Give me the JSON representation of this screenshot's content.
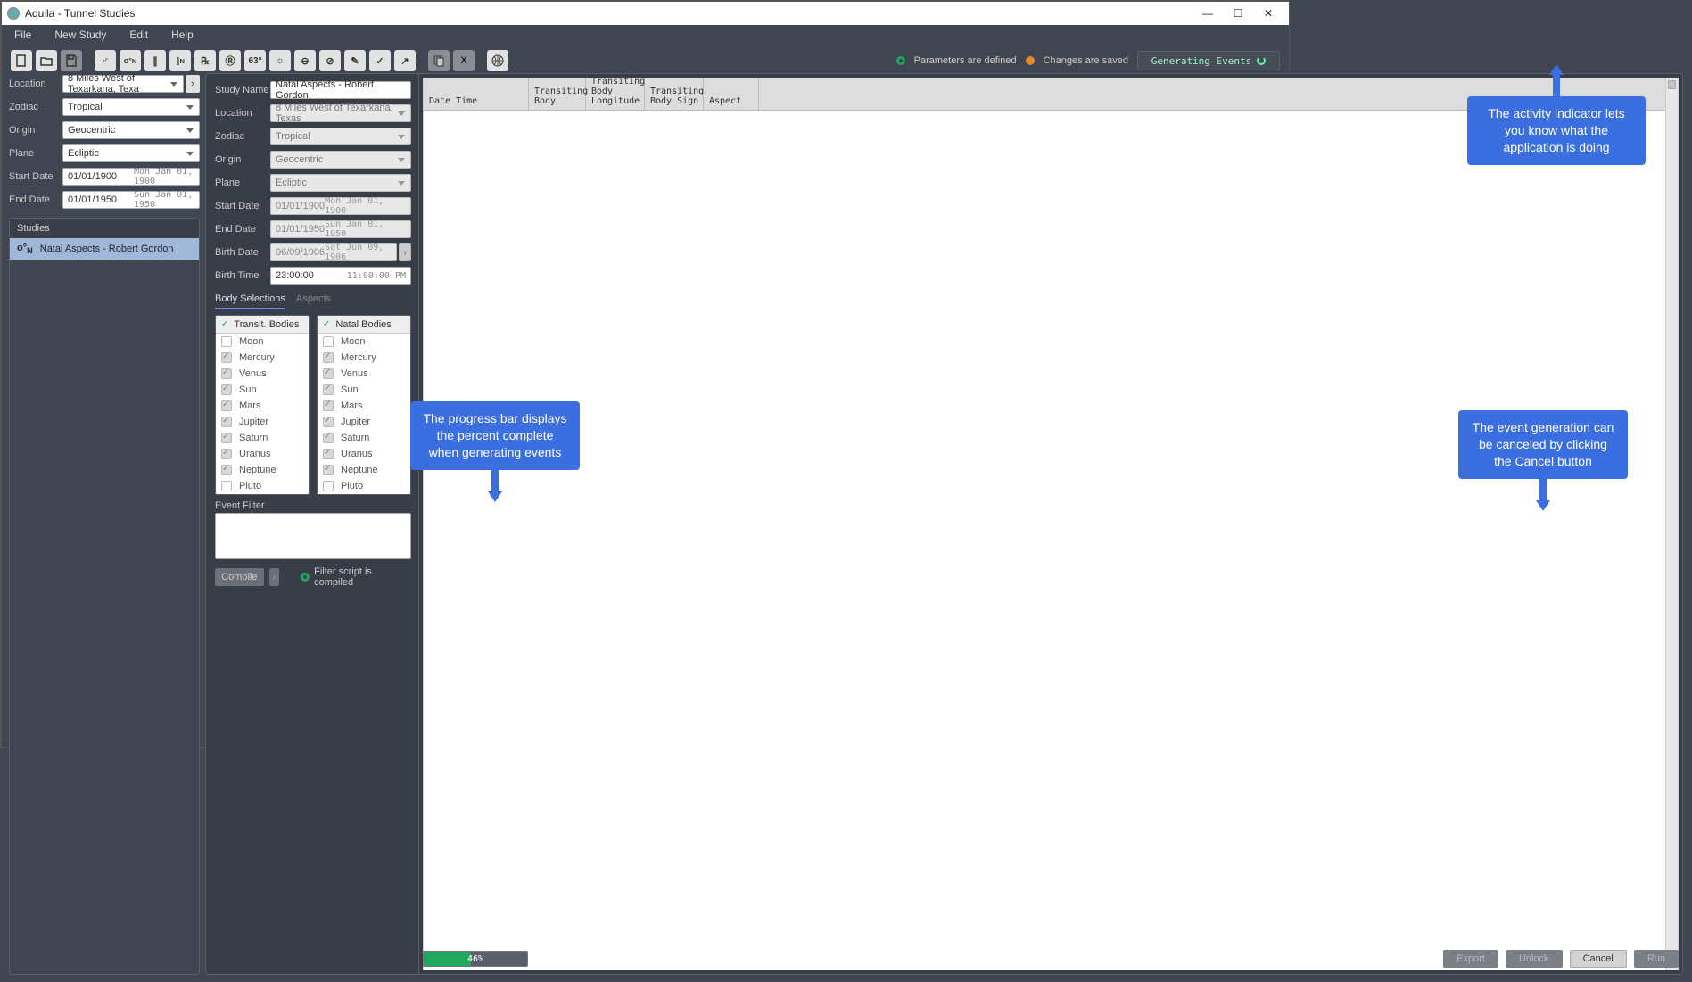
{
  "window": {
    "title": "Aquila - Tunnel Studies"
  },
  "menu": {
    "file": "File",
    "new_study": "New Study",
    "edit": "Edit",
    "help": "Help"
  },
  "status": {
    "params": "Parameters are defined",
    "saved": "Changes are saved",
    "generating": "Generating Events"
  },
  "left": {
    "location_label": "Location",
    "location_value": "8 Miles West of Texarkana, Texa",
    "zodiac_label": "Zodiac",
    "zodiac_value": "Tropical",
    "origin_label": "Origin",
    "origin_value": "Geocentric",
    "plane_label": "Plane",
    "plane_value": "Ecliptic",
    "start_label": "Start Date",
    "start_value": "01/01/1900",
    "start_day": "Mon Jan 01, 1900",
    "end_label": "End Date",
    "end_value": "01/01/1950",
    "end_day": "Sun Jan 01, 1950",
    "studies_header": "Studies",
    "study_item": "Natal Aspects - Robert Gordon"
  },
  "center": {
    "study_name_label": "Study Name",
    "study_name_value": "Natal Aspects - Robert Gordon",
    "location_label": "Location",
    "location_value": "8 Miles West of Texarkana, Texas",
    "zodiac_label": "Zodiac",
    "zodiac_value": "Tropical",
    "origin_label": "Origin",
    "origin_value": "Geocentric",
    "plane_label": "Plane",
    "plane_value": "Ecliptic",
    "start_label": "Start Date",
    "start_value": "01/01/1900",
    "start_day": "Mon Jan 01, 1900",
    "end_label": "End Date",
    "end_value": "01/01/1950",
    "end_day": "Sun Jan 01, 1950",
    "birth_date_label": "Birth Date",
    "birth_date_value": "06/09/1906",
    "birth_date_day": "Sat Jun 09, 1906",
    "birth_time_label": "Birth Time",
    "birth_time_value": "23:00:00",
    "birth_time_lbl": "11:00:00 PM",
    "tab_body": "Body Selections",
    "tab_aspects": "Aspects",
    "transit_header": "Transit. Bodies",
    "natal_header": "Natal Bodies",
    "bodies": [
      "Moon",
      "Mercury",
      "Venus",
      "Sun",
      "Mars",
      "Jupiter",
      "Saturn",
      "Uranus",
      "Neptune",
      "Pluto"
    ],
    "bodies_checked": [
      false,
      true,
      true,
      true,
      true,
      true,
      true,
      true,
      true,
      false
    ],
    "event_filter_label": "Event Filter",
    "compile_label": "Compile",
    "compile_status": "Filter script is compiled"
  },
  "grid": {
    "cols": {
      "dt": "Date Time",
      "tb": "Transiting Body",
      "tl": "Transiting Body Longitude",
      "ts": "Transiting Body Sign",
      "as": "Aspect"
    }
  },
  "progress": {
    "percent": "46%",
    "fill": 46
  },
  "buttons": {
    "export": "Export",
    "unlock": "Unlock",
    "cancel": "Cancel",
    "run": "Run"
  },
  "callouts": {
    "c1": "The activity indicator lets you know what the application is doing",
    "c2": "The progress bar displays the percent complete when generating events",
    "c3": "The event generation can be canceled by clicking the Cancel button"
  }
}
